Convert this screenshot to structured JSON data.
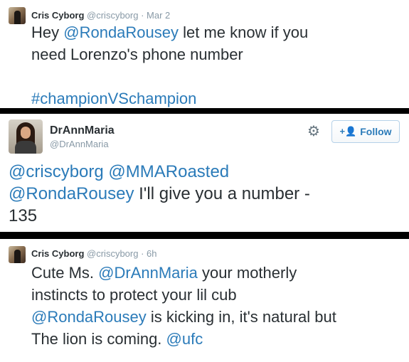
{
  "tweet1": {
    "name": "Cris Cyborg",
    "handle": "@criscyborg",
    "time": "· Mar 2",
    "lines": [
      [
        {
          "t": "Hey "
        },
        {
          "t": "@RondaRousey",
          "link": true
        },
        {
          "t": " let me know if you"
        }
      ],
      [
        {
          "t": "need Lorenzo's phone number"
        }
      ],
      [
        {
          "t": ""
        }
      ],
      [
        {
          "t": "#championVSchampion",
          "link": true
        }
      ]
    ]
  },
  "tweet2": {
    "name": "DrAnnMaria",
    "handle": "@DrAnnMaria",
    "follow_label": "Follow",
    "gear_icon": "gear-icon",
    "follow_icon": "add-user-icon",
    "lines": [
      [
        {
          "t": "@criscyborg",
          "link": true
        },
        {
          "t": " "
        },
        {
          "t": "@MMARoasted",
          "link": true
        }
      ],
      [
        {
          "t": "@RondaRousey",
          "link": true
        },
        {
          "t": " I'll give you a number -"
        }
      ],
      [
        {
          "t": "135"
        }
      ]
    ]
  },
  "tweet3": {
    "name": "Cris Cyborg",
    "handle": "@criscyborg",
    "time": "· 6h",
    "lines": [
      [
        {
          "t": "Cute Ms. "
        },
        {
          "t": "@DrAnnMaria",
          "link": true
        },
        {
          "t": " your motherly"
        }
      ],
      [
        {
          "t": "instincts to protect your lil cub"
        }
      ],
      [
        {
          "t": "@RondaRousey",
          "link": true
        },
        {
          "t": " is kicking in, it's natural but"
        }
      ],
      [
        {
          "t": "The lion is coming. "
        },
        {
          "t": "@ufc",
          "link": true
        }
      ]
    ]
  },
  "colors": {
    "link": "#2b7bb9",
    "text": "#292f33",
    "muted": "#8899a6",
    "divider": "#000000"
  }
}
